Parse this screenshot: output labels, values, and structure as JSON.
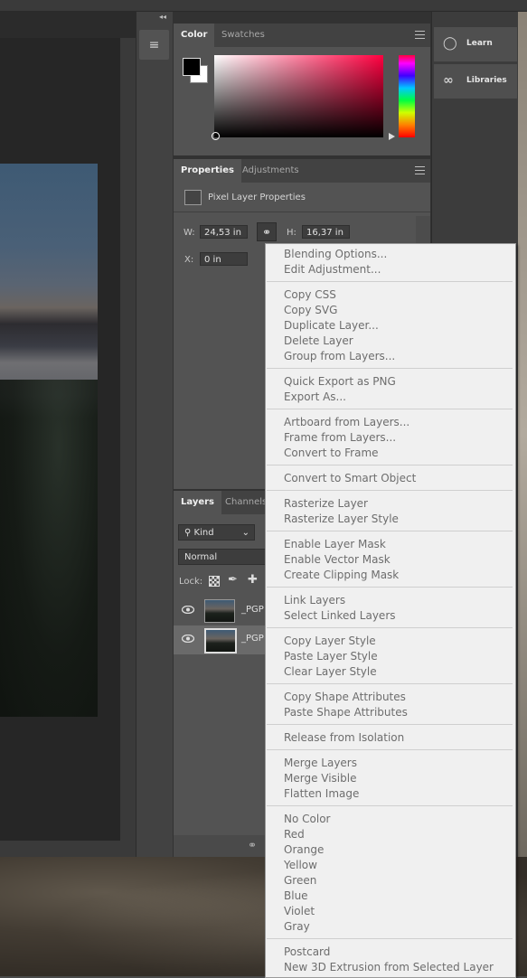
{
  "color_panel": {
    "tabs": [
      "Color",
      "Swatches"
    ]
  },
  "properties_panel": {
    "tabs": [
      "Properties",
      "Adjustments"
    ],
    "title": "Pixel Layer Properties",
    "w_label": "W:",
    "w_value": "24,53 in",
    "h_label": "H:",
    "h_value": "16,37 in",
    "x_label": "X:",
    "x_value": "0 in"
  },
  "layers_panel": {
    "tabs": [
      "Layers",
      "Channels"
    ],
    "filter_label": "Kind",
    "blend_mode": "Normal",
    "lock_label": "Lock:",
    "layers": [
      "_PGP",
      "_PGP"
    ]
  },
  "right_panel": {
    "learn": "Learn",
    "libraries": "Libraries"
  },
  "context_menu": {
    "groups": [
      [
        "Blending Options...",
        "Edit Adjustment..."
      ],
      [
        "Copy CSS",
        "Copy SVG",
        "Duplicate Layer...",
        "Delete Layer",
        "Group from Layers..."
      ],
      [
        "Quick Export as PNG",
        "Export As..."
      ],
      [
        "Artboard from Layers...",
        "Frame from Layers...",
        "Convert to Frame"
      ],
      [
        "Convert to Smart Object"
      ],
      [
        "Rasterize Layer",
        "Rasterize Layer Style"
      ],
      [
        "Enable Layer Mask",
        "Enable Vector Mask",
        "Create Clipping Mask"
      ],
      [
        "Link Layers",
        "Select Linked Layers"
      ],
      [
        "Copy Layer Style",
        "Paste Layer Style",
        "Clear Layer Style"
      ],
      [
        "Copy Shape Attributes",
        "Paste Shape Attributes"
      ],
      [
        "Release from Isolation"
      ],
      [
        "Merge Layers",
        "Merge Visible",
        "Flatten Image"
      ],
      [
        "No Color",
        "Red",
        "Orange",
        "Yellow",
        "Green",
        "Blue",
        "Violet",
        "Gray"
      ],
      [
        "Postcard",
        "New 3D Extrusion from Selected Layer"
      ]
    ]
  }
}
